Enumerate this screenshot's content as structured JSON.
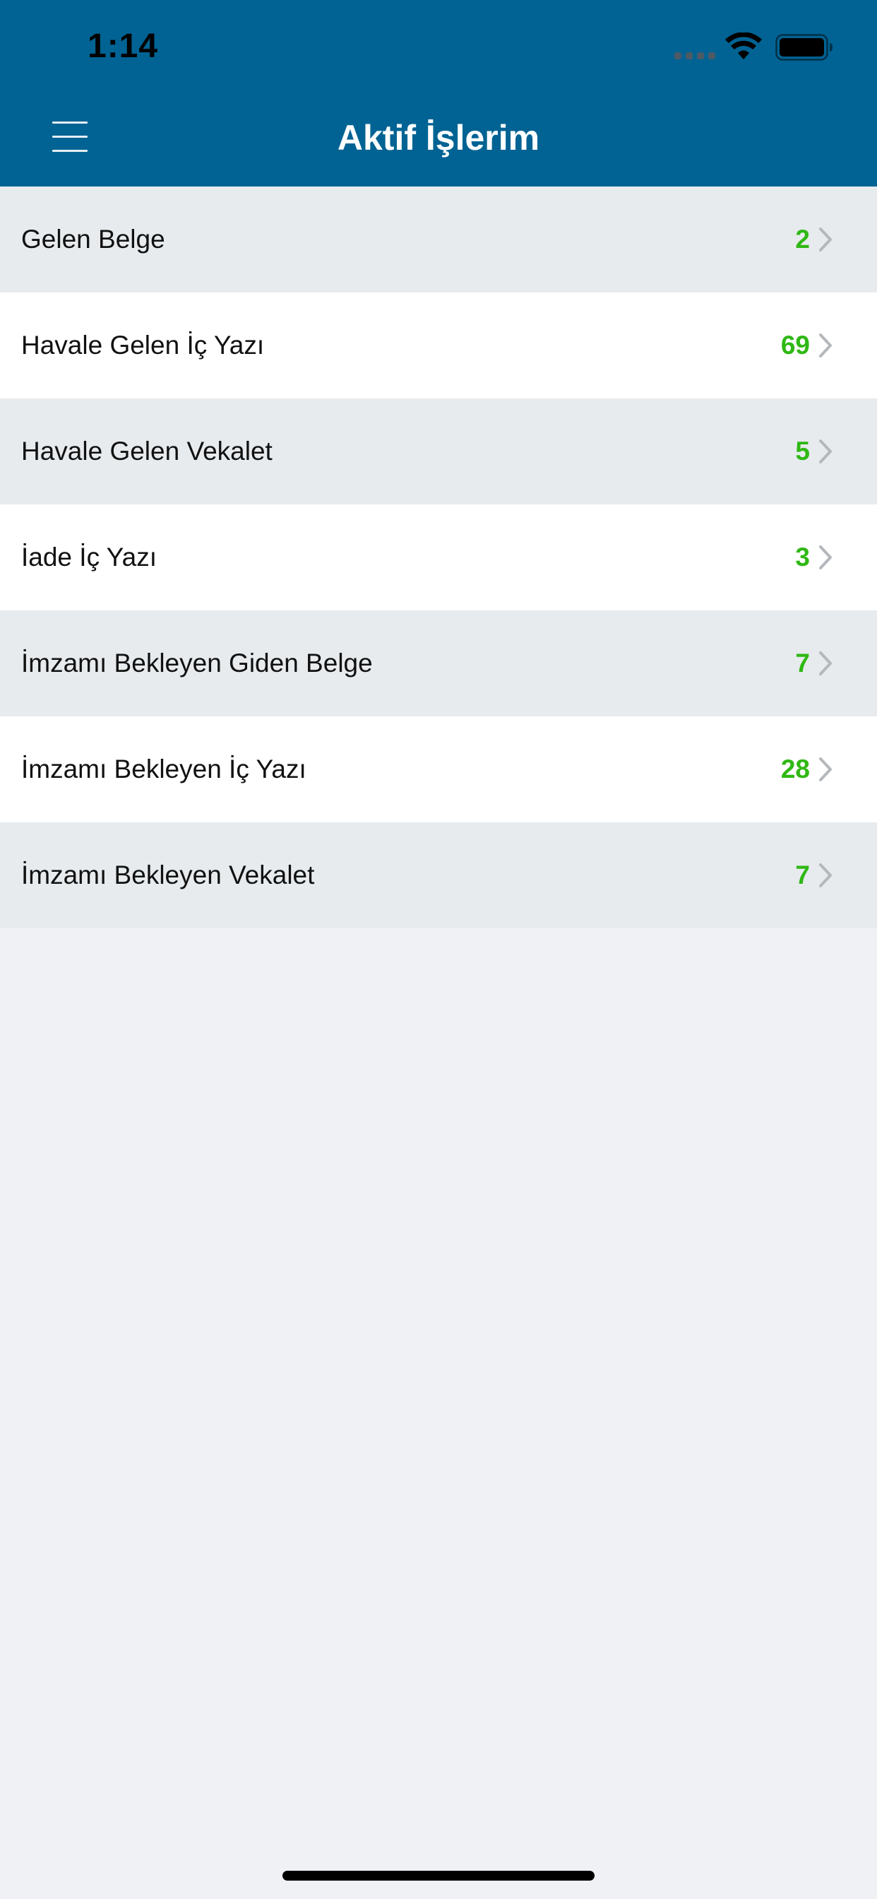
{
  "status_bar": {
    "time": "1:14",
    "icons": [
      "signal-icon",
      "wifi-icon",
      "battery-icon"
    ]
  },
  "nav": {
    "title": "Aktif İşlerim",
    "menu_icon": "hamburger-menu-icon"
  },
  "colors": {
    "nav_background": "#006393",
    "count_color": "#2fb814",
    "row_shaded": "#e7ebee",
    "row_plain": "#ffffff",
    "page_background": "#f0f1f5"
  },
  "items": [
    {
      "label": "Gelen Belge",
      "count": "2"
    },
    {
      "label": "Havale Gelen İç Yazı",
      "count": "69"
    },
    {
      "label": "Havale Gelen Vekalet",
      "count": "5"
    },
    {
      "label": "İade İç Yazı",
      "count": "3"
    },
    {
      "label": "İmzamı Bekleyen Giden Belge",
      "count": "7"
    },
    {
      "label": "İmzamı Bekleyen İç Yazı",
      "count": "28"
    },
    {
      "label": "İmzamı Bekleyen Vekalet",
      "count": "7"
    }
  ]
}
